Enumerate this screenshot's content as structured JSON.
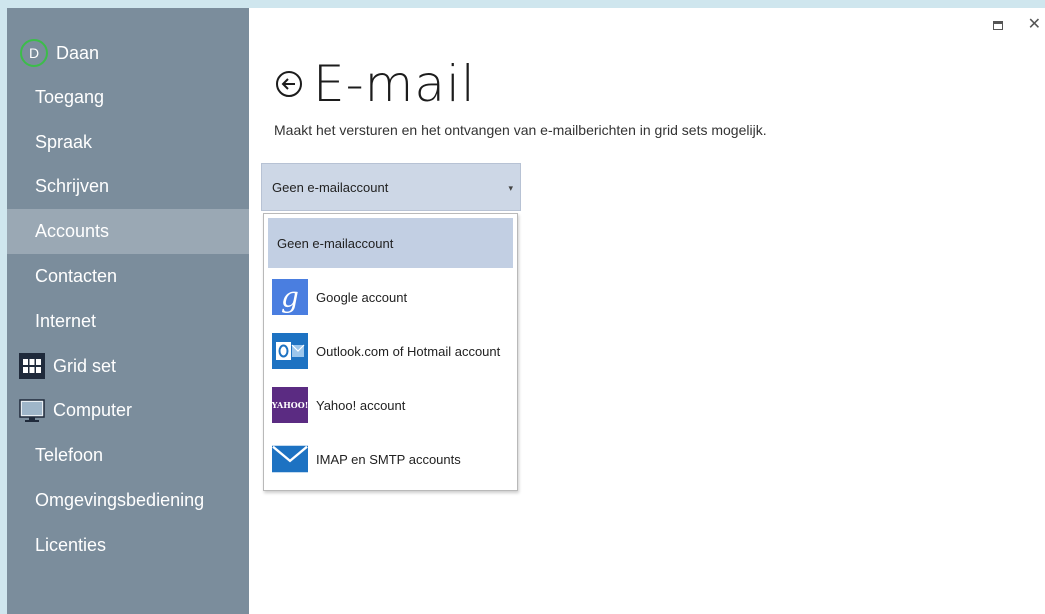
{
  "window": {
    "maximize_icon": "maximize-icon",
    "close_icon": "close-icon",
    "close_glyph": "✕"
  },
  "sidebar": {
    "user": {
      "initial": "D",
      "name": "Daan"
    },
    "items": [
      {
        "label": "Toegang",
        "active": false
      },
      {
        "label": "Spraak",
        "active": false
      },
      {
        "label": "Schrijven",
        "active": false
      },
      {
        "label": "Accounts",
        "active": true
      },
      {
        "label": "Contacten",
        "active": false
      },
      {
        "label": "Internet",
        "active": false
      },
      {
        "label": "Grid set",
        "active": false,
        "icon": "grid-set-icon"
      },
      {
        "label": "Computer",
        "active": false,
        "icon": "computer-icon"
      },
      {
        "label": "Telefoon",
        "active": false
      },
      {
        "label": "Omgevingsbediening",
        "active": false
      },
      {
        "label": "Licenties",
        "active": false
      }
    ]
  },
  "main": {
    "title": "E-mail",
    "description": "Maakt het versturen en het ontvangen van e-mailberichten in grid sets mogelijk.",
    "select": {
      "value": "Geen e-mailaccount",
      "options": [
        {
          "label": "Geen e-mailaccount",
          "selected": true
        },
        {
          "label": "Google account",
          "icon": "google-icon",
          "logo_text": "g"
        },
        {
          "label": "Outlook.com of Hotmail account",
          "icon": "outlook-icon"
        },
        {
          "label": "Yahoo! account",
          "icon": "yahoo-icon",
          "logo_text": "YAHOO!"
        },
        {
          "label": "IMAP en SMTP accounts",
          "icon": "mail-envelope-icon"
        }
      ]
    }
  },
  "colors": {
    "sidebar_bg": "#7b8d9c",
    "sidebar_active": "#9aa8b4",
    "avatar_ring": "#3cbd4a",
    "select_bg": "#cdd7e6",
    "selected_option_bg": "#c2cfe3"
  }
}
